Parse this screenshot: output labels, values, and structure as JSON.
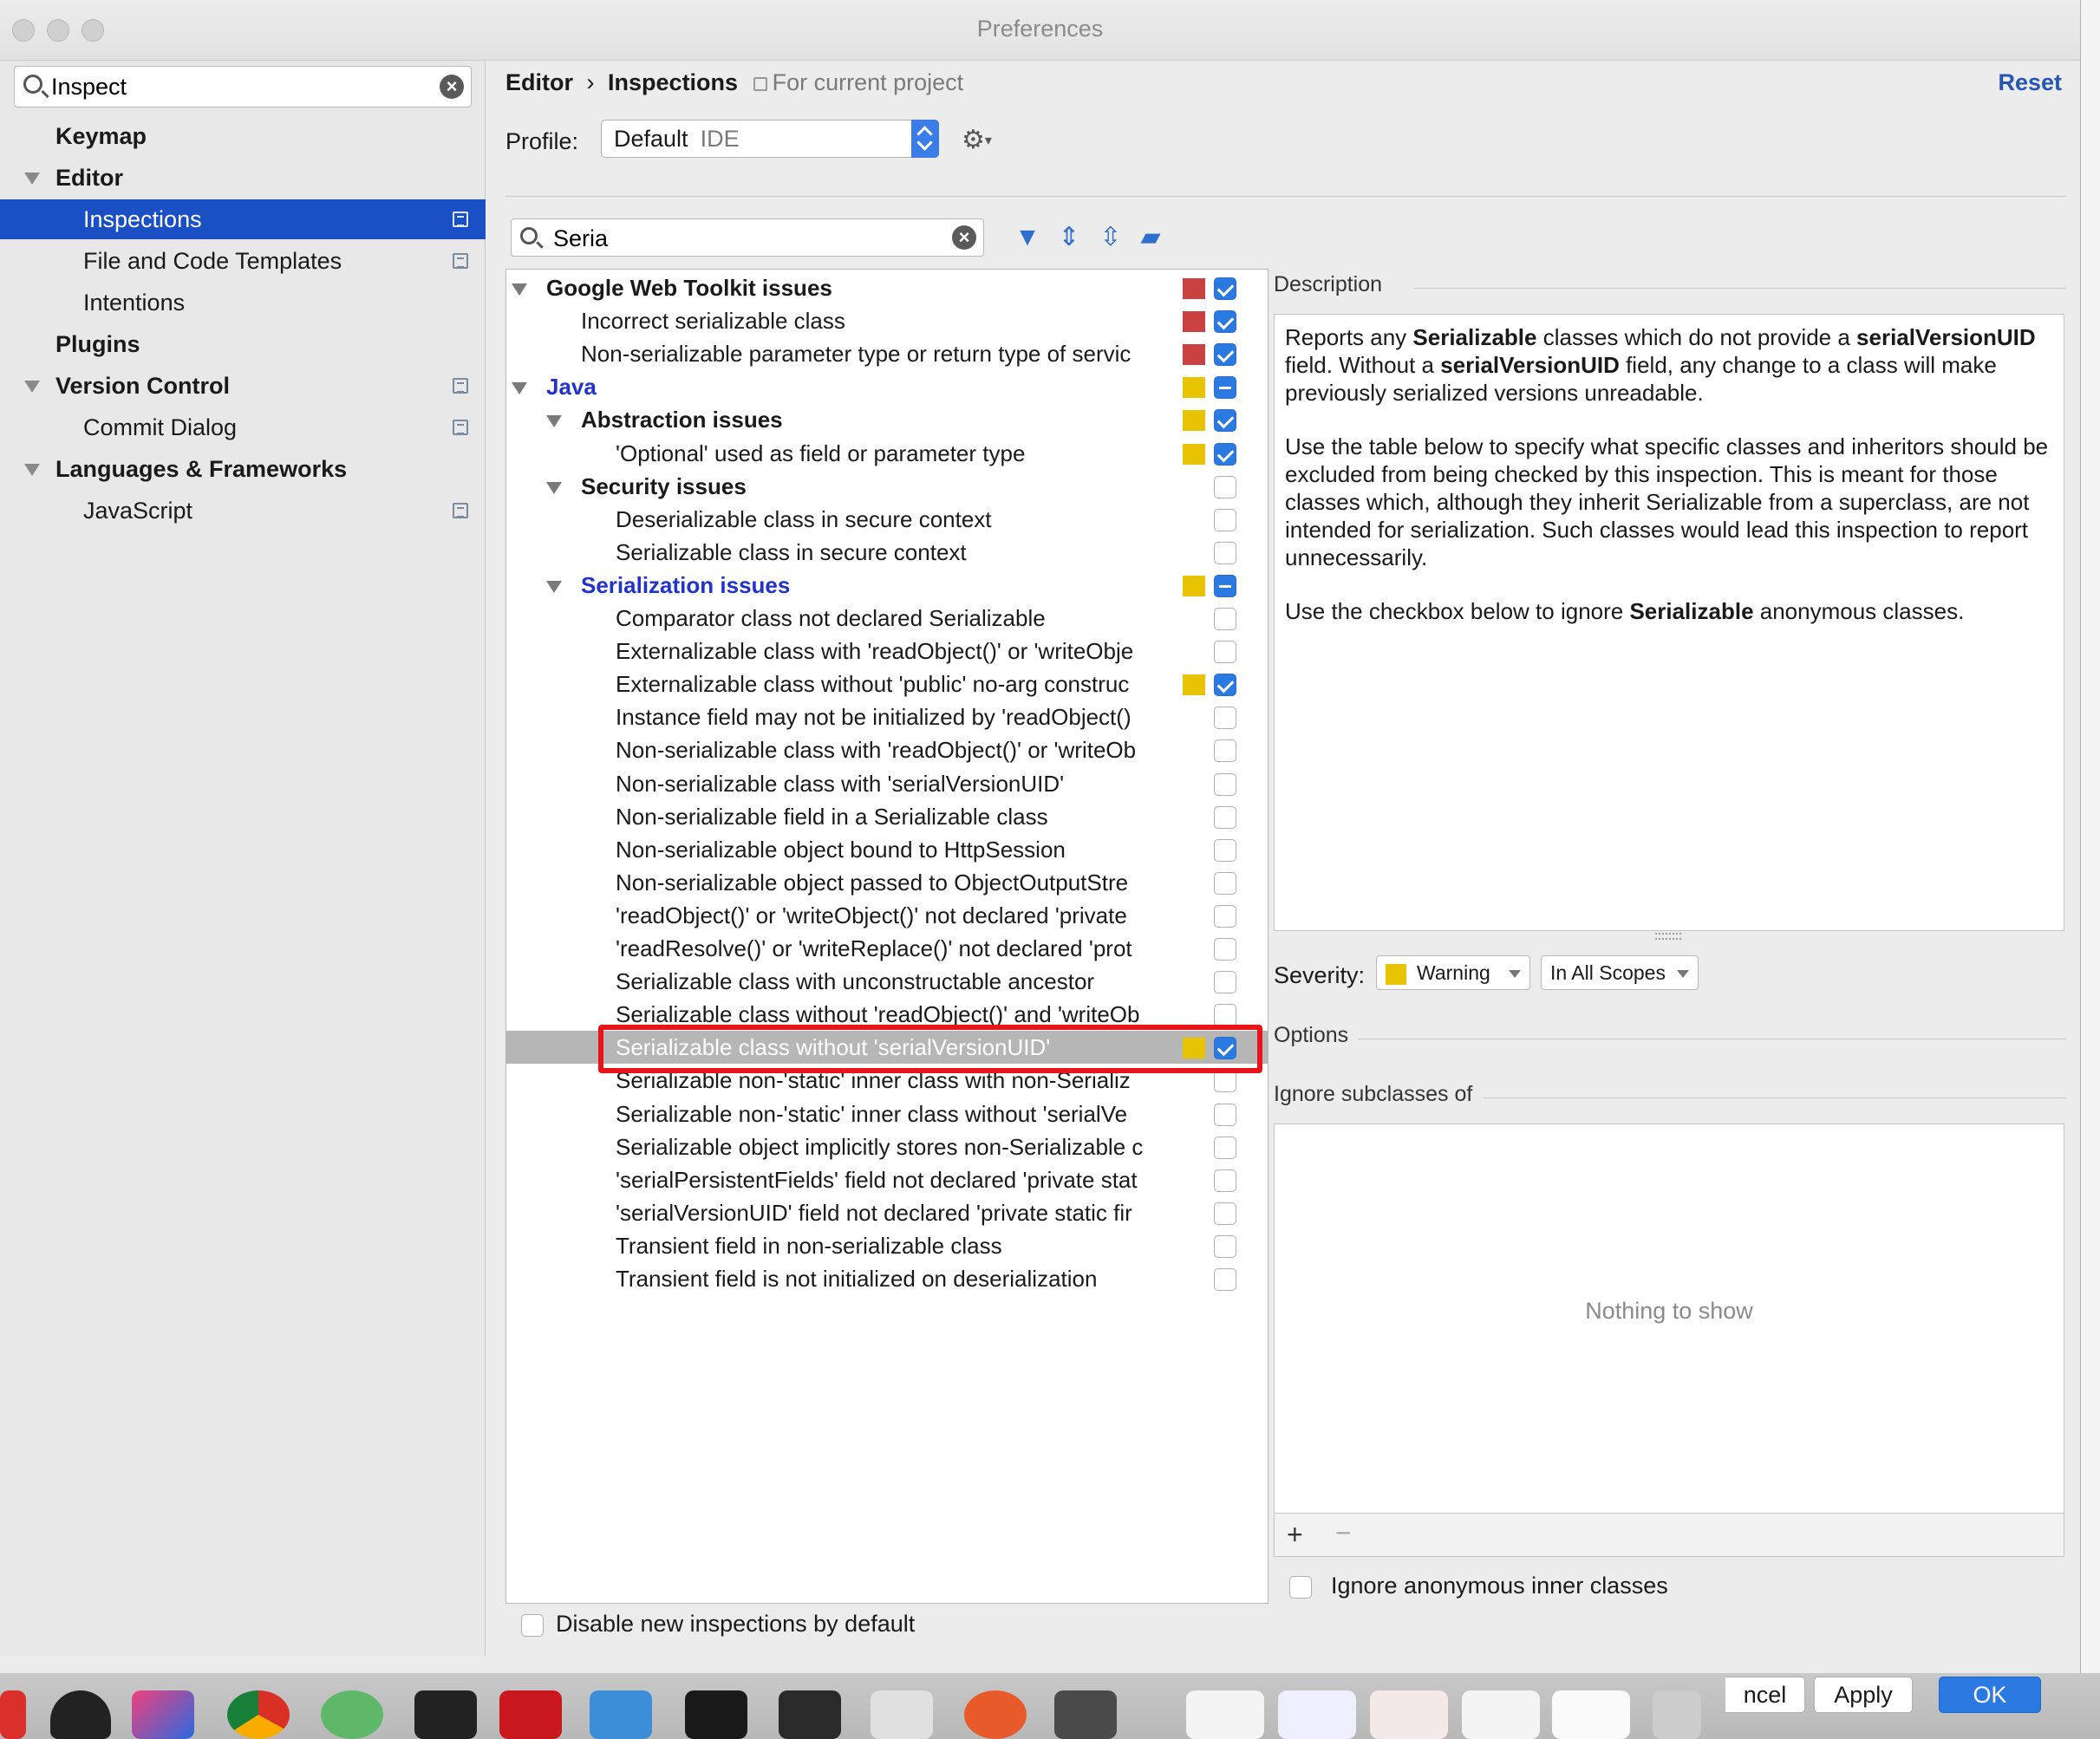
{
  "window": {
    "title": "Preferences"
  },
  "sidebar": {
    "search": {
      "value": "Inspect"
    },
    "items": [
      {
        "label": "Keymap",
        "bold": true,
        "indent": 0,
        "expand": false,
        "copy": false
      },
      {
        "label": "Editor",
        "bold": true,
        "indent": 0,
        "expand": true,
        "copy": false
      },
      {
        "label": "Inspections",
        "bold": false,
        "indent": 1,
        "expand": false,
        "copy": true,
        "selected": true
      },
      {
        "label": "File and Code Templates",
        "bold": false,
        "indent": 1,
        "expand": false,
        "copy": true
      },
      {
        "label": "Intentions",
        "bold": false,
        "indent": 1,
        "expand": false,
        "copy": false
      },
      {
        "label": "Plugins",
        "bold": true,
        "indent": 0,
        "expand": false,
        "copy": false
      },
      {
        "label": "Version Control",
        "bold": true,
        "indent": 0,
        "expand": true,
        "copy": true
      },
      {
        "label": "Commit Dialog",
        "bold": false,
        "indent": 1,
        "expand": false,
        "copy": true
      },
      {
        "label": "Languages & Frameworks",
        "bold": true,
        "indent": 0,
        "expand": true,
        "copy": false
      },
      {
        "label": "JavaScript",
        "bold": false,
        "indent": 1,
        "expand": false,
        "copy": true
      }
    ]
  },
  "header": {
    "crumb_root": "Editor",
    "crumb_sep": "›",
    "crumb_page": "Inspections",
    "scope": "For current project",
    "reset": "Reset"
  },
  "profile": {
    "label": "Profile:",
    "value": "Default",
    "sub": "IDE"
  },
  "filter": {
    "value": "Seria"
  },
  "colors": {
    "error": "#c94141",
    "warning": "#e8c400",
    "accent": "#2a7ae2"
  },
  "tree": [
    {
      "label": "Google Web Toolkit issues",
      "level": 0,
      "style": "bold",
      "expand": true,
      "sev": "error",
      "check": "checked"
    },
    {
      "label": "Incorrect serializable class",
      "level": 1,
      "style": "",
      "sev": "error",
      "check": "checked"
    },
    {
      "label": "Non-serializable parameter type or return type of servic",
      "level": 1,
      "style": "",
      "sev": "error",
      "check": "checked"
    },
    {
      "label": "Java",
      "level": 0,
      "style": "blue",
      "expand": true,
      "sev": "warning",
      "check": "mixed"
    },
    {
      "label": "Abstraction issues",
      "level": 1,
      "style": "bold",
      "expand": true,
      "sev": "warning",
      "check": "checked"
    },
    {
      "label": "'Optional' used as field or parameter type",
      "level": 2,
      "style": "",
      "sev": "warning",
      "check": "checked"
    },
    {
      "label": "Security issues",
      "level": 1,
      "style": "bold",
      "expand": true,
      "sev": "",
      "check": "none"
    },
    {
      "label": "Deserializable class in secure context",
      "level": 2,
      "style": "",
      "sev": "",
      "check": "none"
    },
    {
      "label": "Serializable class in secure context",
      "level": 2,
      "style": "",
      "sev": "",
      "check": "none"
    },
    {
      "label": "Serialization issues",
      "level": 1,
      "style": "blue",
      "expand": true,
      "sev": "warning",
      "check": "mixed"
    },
    {
      "label": "Comparator class not declared Serializable",
      "level": 2,
      "style": "",
      "sev": "",
      "check": "none"
    },
    {
      "label": "Externalizable class with 'readObject()' or 'writeObje",
      "level": 2,
      "style": "",
      "sev": "",
      "check": "none"
    },
    {
      "label": "Externalizable class without 'public' no-arg construc",
      "level": 2,
      "style": "",
      "sev": "warning",
      "check": "checked"
    },
    {
      "label": "Instance field may not be initialized by 'readObject()",
      "level": 2,
      "style": "",
      "sev": "",
      "check": "none"
    },
    {
      "label": "Non-serializable class with 'readObject()' or 'writeOb",
      "level": 2,
      "style": "",
      "sev": "",
      "check": "none"
    },
    {
      "label": "Non-serializable class with 'serialVersionUID'",
      "level": 2,
      "style": "",
      "sev": "",
      "check": "none"
    },
    {
      "label": "Non-serializable field in a Serializable class",
      "level": 2,
      "style": "",
      "sev": "",
      "check": "none"
    },
    {
      "label": "Non-serializable object bound to HttpSession",
      "level": 2,
      "style": "",
      "sev": "",
      "check": "none"
    },
    {
      "label": "Non-serializable object passed to ObjectOutputStre",
      "level": 2,
      "style": "",
      "sev": "",
      "check": "none"
    },
    {
      "label": "'readObject()' or 'writeObject()' not declared 'private",
      "level": 2,
      "style": "",
      "sev": "",
      "check": "none"
    },
    {
      "label": "'readResolve()' or 'writeReplace()' not declared 'prot",
      "level": 2,
      "style": "",
      "sev": "",
      "check": "none"
    },
    {
      "label": "Serializable class with unconstructable ancestor",
      "level": 2,
      "style": "",
      "sev": "",
      "check": "none"
    },
    {
      "label": "Serializable class without 'readObject()' and 'writeOb",
      "level": 2,
      "style": "",
      "sev": "",
      "check": "none"
    },
    {
      "label": "Serializable class without 'serialVersionUID'",
      "level": 2,
      "style": "",
      "sev": "warning",
      "check": "checked",
      "selected": true
    },
    {
      "label": "Serializable non-'static' inner class with non-Serializ",
      "level": 2,
      "style": "",
      "sev": "",
      "check": "none"
    },
    {
      "label": "Serializable non-'static' inner class without 'serialVe",
      "level": 2,
      "style": "",
      "sev": "",
      "check": "none"
    },
    {
      "label": "Serializable object implicitly stores non-Serializable c",
      "level": 2,
      "style": "",
      "sev": "",
      "check": "none"
    },
    {
      "label": "'serialPersistentFields' field not declared 'private stat",
      "level": 2,
      "style": "",
      "sev": "",
      "check": "none"
    },
    {
      "label": "'serialVersionUID' field not declared 'private static fir",
      "level": 2,
      "style": "",
      "sev": "",
      "check": "none"
    },
    {
      "label": "Transient field in non-serializable class",
      "level": 2,
      "style": "",
      "sev": "",
      "check": "none"
    },
    {
      "label": "Transient field is not initialized on deserialization",
      "level": 2,
      "style": "",
      "sev": "",
      "check": "none"
    }
  ],
  "disable_new": "Disable new inspections by default",
  "description": {
    "label": "Description",
    "p1a": "Reports any ",
    "p1b": "Serializable",
    "p1c": " classes which do not provide a ",
    "p1d": "serialVersionUID",
    "p1e": " field. Without a ",
    "p1f": "serialVersionUID",
    "p1g": " field, any change to a class will make previously serialized versions unreadable.",
    "p2": "Use the table below to specify what specific classes and inheritors should be excluded from being checked by this inspection. This is meant for those classes which, although they inherit Serializable from a superclass, are not intended for serialization. Such classes would lead this inspection to report unnecessarily.",
    "p3a": "Use the checkbox below to ignore ",
    "p3b": "Serializable",
    "p3c": " anonymous classes."
  },
  "severity": {
    "label": "Severity:",
    "value": "Warning",
    "scope": "In All Scopes"
  },
  "options": {
    "label": "Options",
    "ignore_label": "Ignore subclasses of",
    "empty": "Nothing to show",
    "plus": "+",
    "minus": "−",
    "anon_label": "Ignore anonymous inner classes"
  },
  "buttons": {
    "cancel": "ncel",
    "apply": "Apply",
    "ok": "OK"
  }
}
